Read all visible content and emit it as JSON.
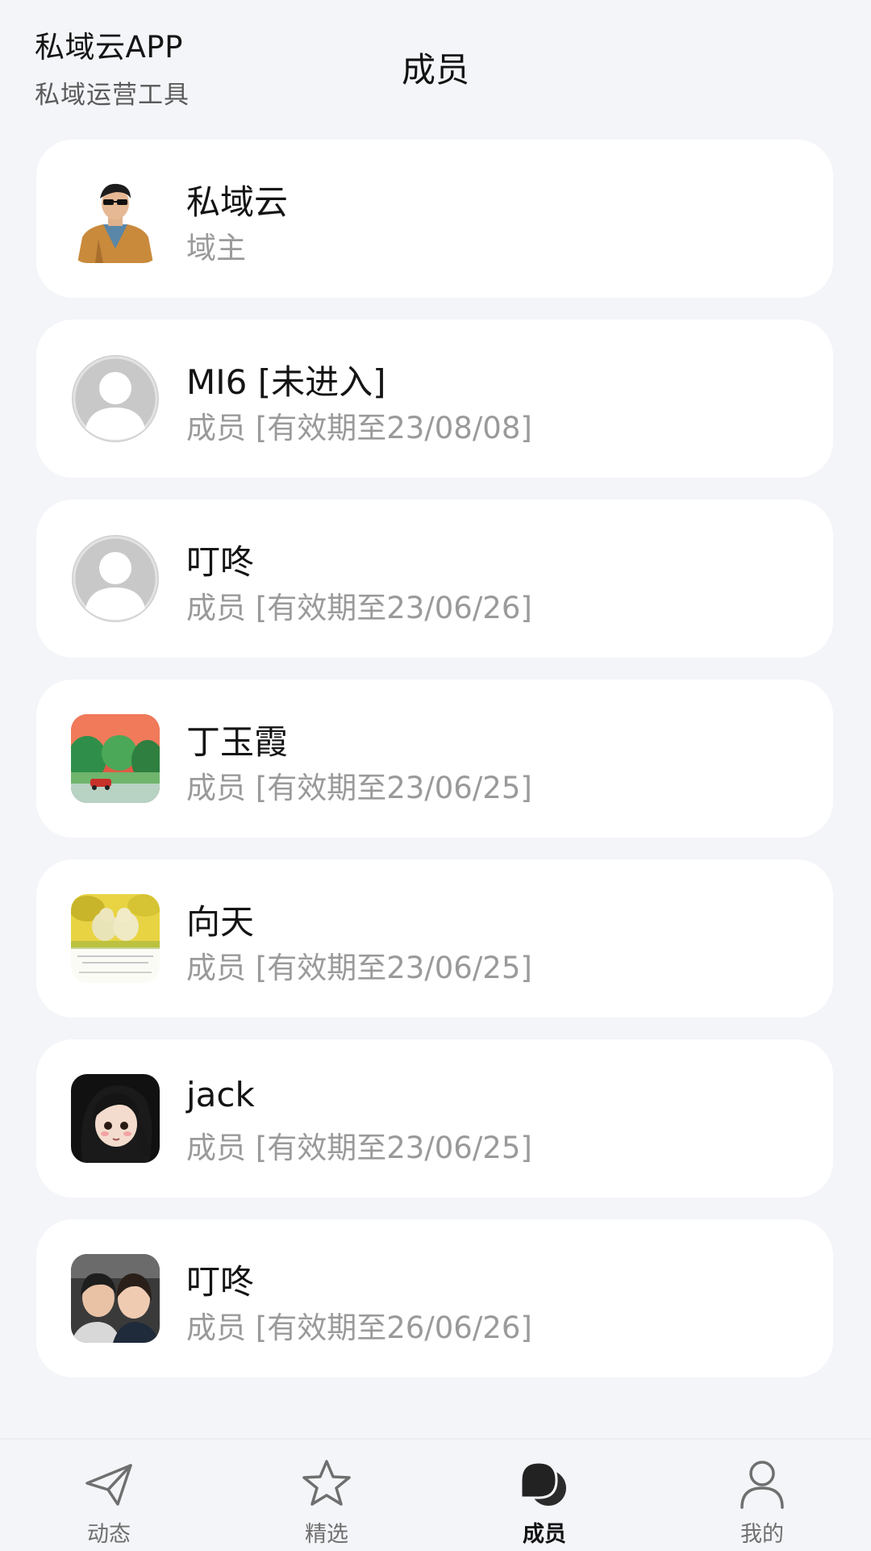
{
  "header": {
    "app_name": "私域云APP",
    "app_subtitle": "私域运营工具",
    "page_title": "成员"
  },
  "members": [
    {
      "name": "私域云",
      "role": "域主",
      "avatar": "photo-man-orange-jacket"
    },
    {
      "name": "MI6 [未进入]",
      "role": "成员 [有效期至23/08/08]",
      "avatar": "default-avatar"
    },
    {
      "name": "叮咚",
      "role": "成员 [有效期至23/06/26]",
      "avatar": "default-avatar"
    },
    {
      "name": "丁玉霞",
      "role": "成员 [有效期至23/06/25]",
      "avatar": "painting-red-sky-trees"
    },
    {
      "name": "向天",
      "role": "成员 [有效期至23/06/25]",
      "avatar": "photo-yellow-birds"
    },
    {
      "name": "jack",
      "role": "成员 [有效期至23/06/25]",
      "avatar": "anime-girl-dark-hair"
    },
    {
      "name": "叮咚",
      "role": "成员 [有效期至26/06/26]",
      "avatar": "photo-two-people-selfie"
    }
  ],
  "tabbar": {
    "items": [
      {
        "label": "动态",
        "icon": "paper-plane-icon",
        "active": false
      },
      {
        "label": "精选",
        "icon": "star-icon",
        "active": false
      },
      {
        "label": "成员",
        "icon": "chat-bubbles-icon",
        "active": true
      },
      {
        "label": "我的",
        "icon": "person-icon",
        "active": false
      }
    ]
  },
  "colors": {
    "background": "#f4f5f9",
    "card": "#ffffff",
    "secondary_text": "#9a9a9a",
    "active_tab": "#111111",
    "inactive_tab": "#6f6f6f"
  }
}
